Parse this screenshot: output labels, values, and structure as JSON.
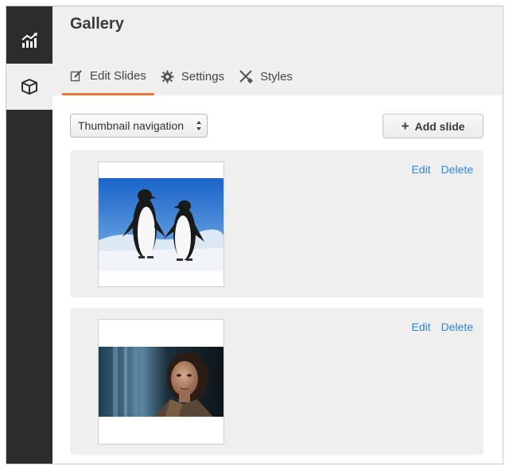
{
  "sidebar": {
    "items": [
      {
        "icon": "analytics-icon"
      },
      {
        "icon": "cube-icon"
      }
    ]
  },
  "header": {
    "title": "Gallery",
    "tabs": [
      {
        "label": "Edit Slides",
        "icon": "edit-icon",
        "active": true
      },
      {
        "label": "Settings",
        "icon": "gear-icon",
        "active": false
      },
      {
        "label": "Styles",
        "icon": "brush-icon",
        "active": false
      }
    ]
  },
  "toolbar": {
    "navigation_select": "Thumbnail navigation",
    "add_slide_label": "Add slide"
  },
  "slides": [
    {
      "image": "penguins-photo",
      "edit_label": "Edit",
      "delete_label": "Delete"
    },
    {
      "image": "woman-portrait-photo",
      "edit_label": "Edit",
      "delete_label": "Delete"
    }
  ],
  "colors": {
    "sidebar_bg": "#2c2c2c",
    "accent_tab": "#e8793a",
    "link": "#2f86d6",
    "panel_bg": "#efefef"
  }
}
